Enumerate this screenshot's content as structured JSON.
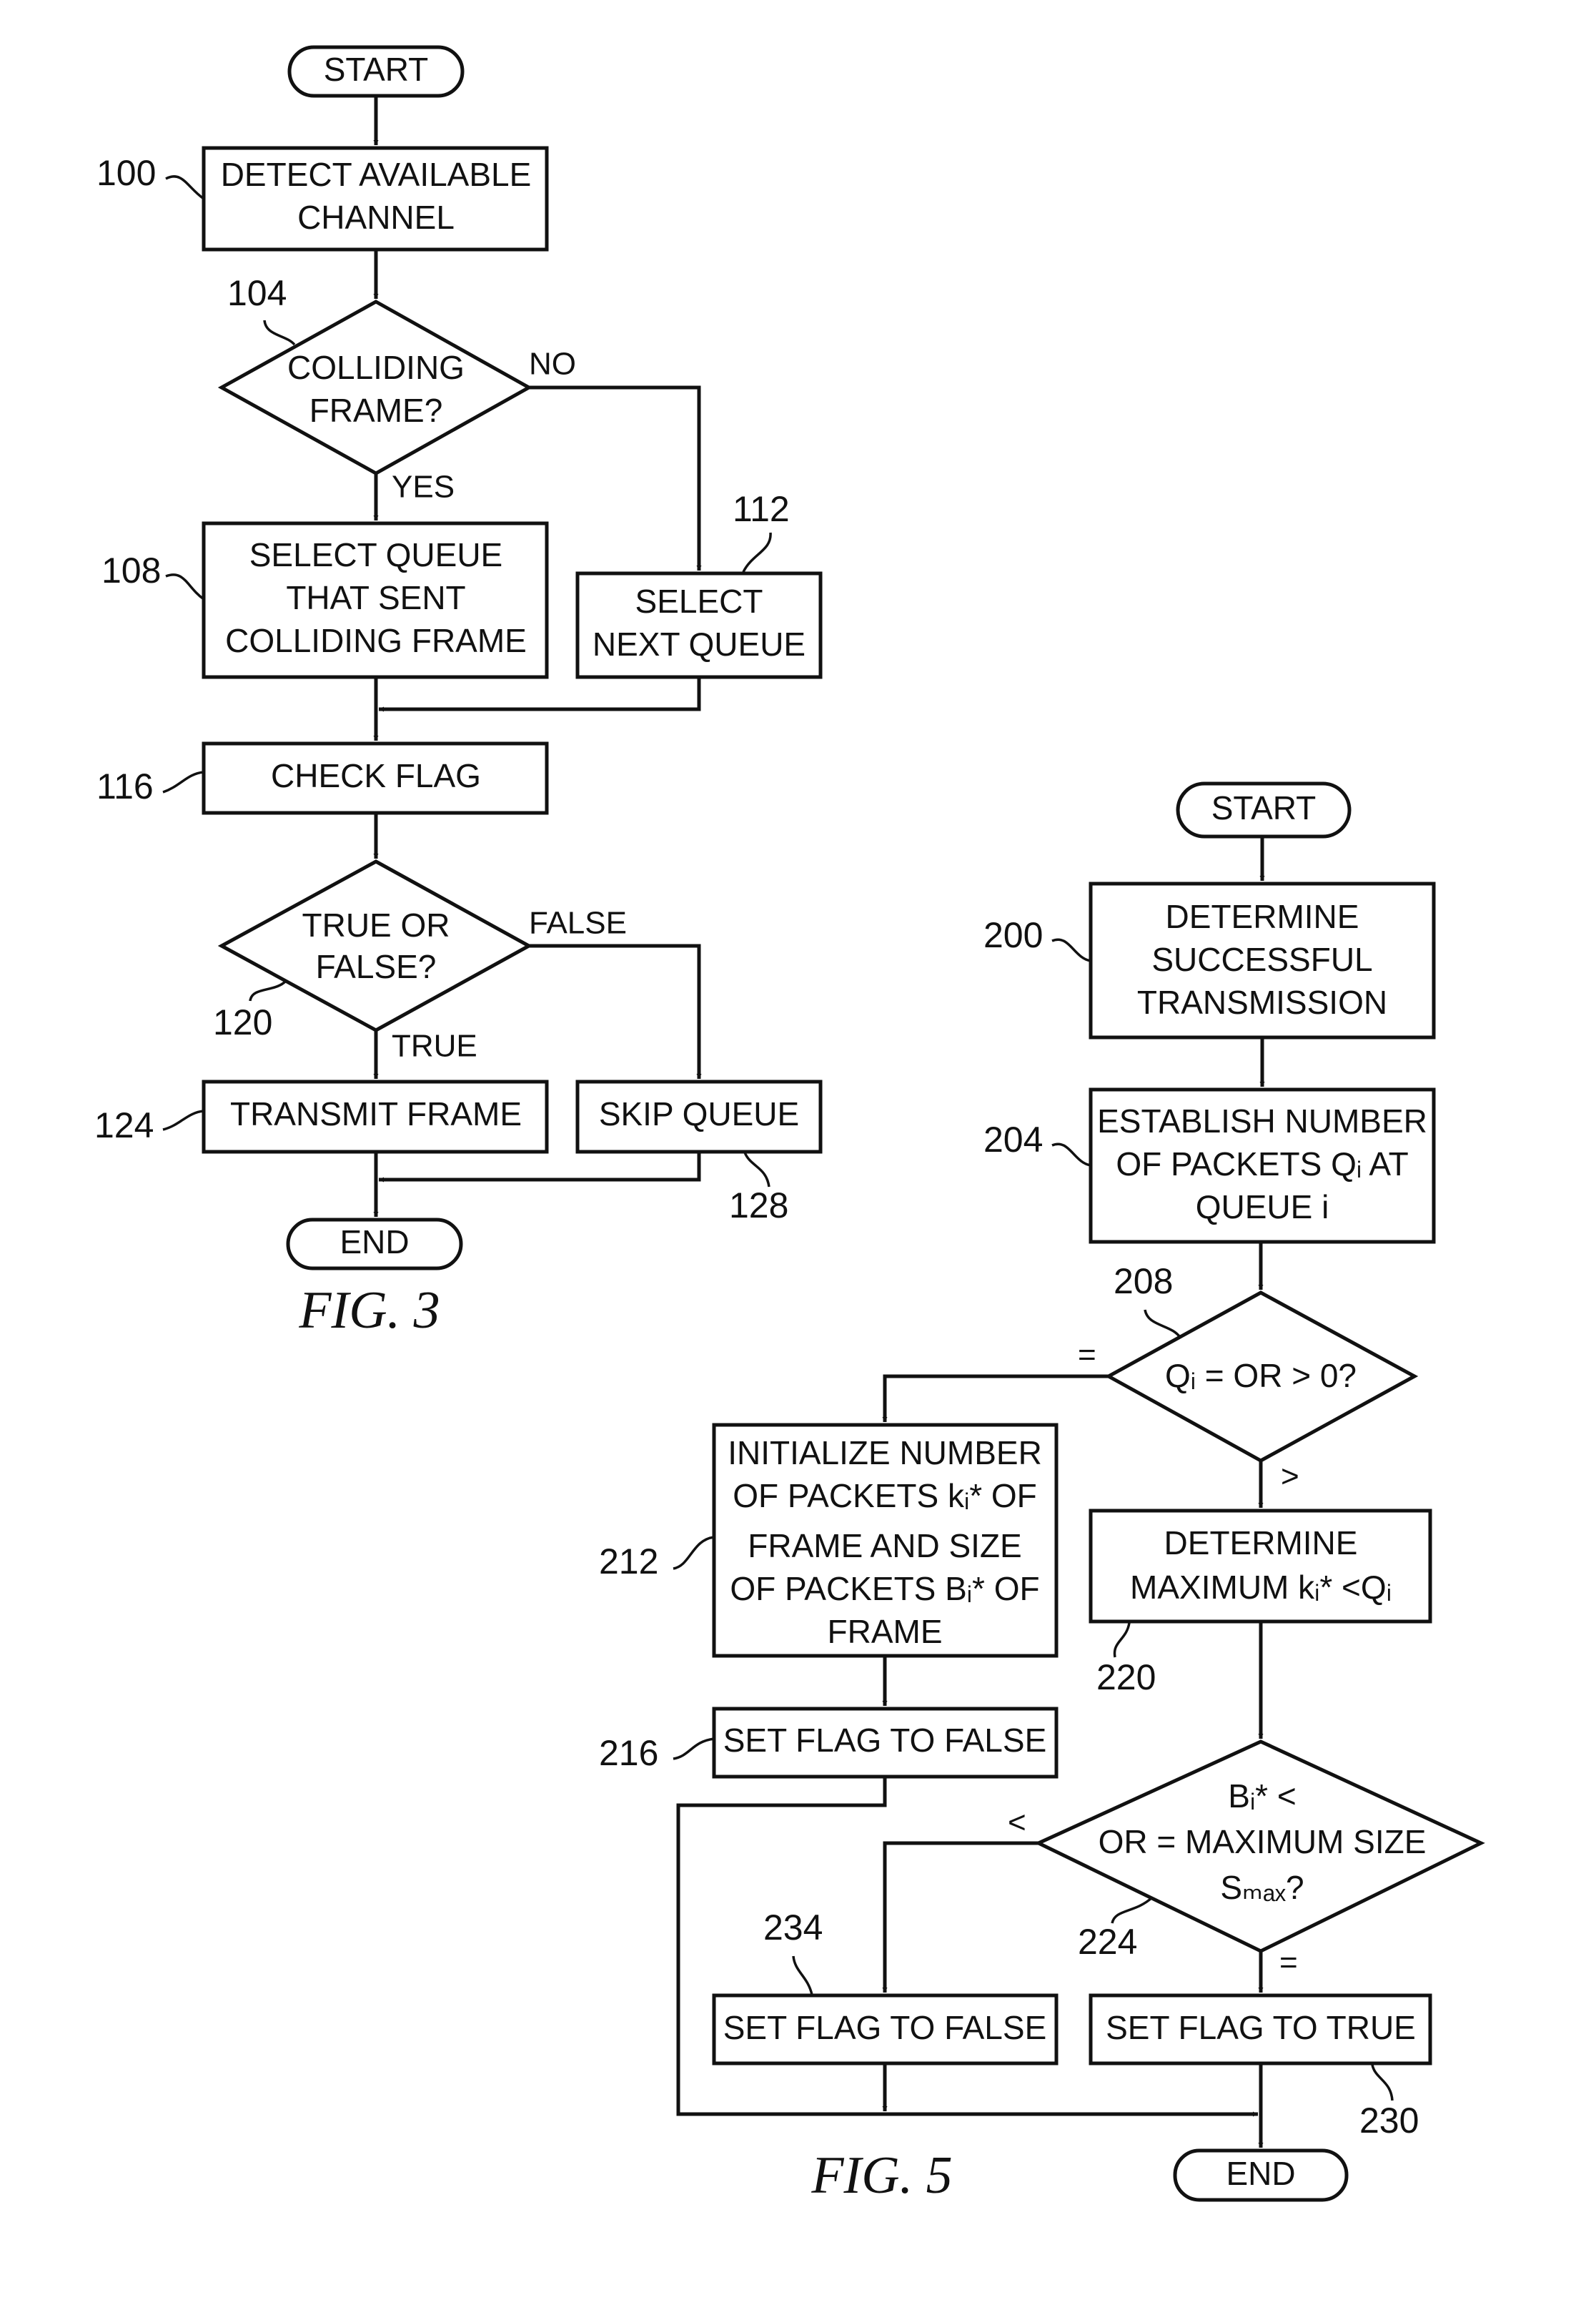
{
  "fig3": {
    "caption": "FIG. 3",
    "start": "START",
    "end": "END",
    "steps": {
      "s100": {
        "ref": "100",
        "lines": [
          "DETECT AVAILABLE",
          "CHANNEL"
        ]
      },
      "s104": {
        "ref": "104",
        "lines": [
          "COLLIDING",
          "FRAME?"
        ],
        "yes": "YES",
        "no": "NO"
      },
      "s108": {
        "ref": "108",
        "lines": [
          "SELECT QUEUE",
          "THAT SENT",
          "COLLIDING FRAME"
        ]
      },
      "s112": {
        "ref": "112",
        "lines": [
          "SELECT",
          "NEXT QUEUE"
        ]
      },
      "s116": {
        "ref": "116",
        "lines": [
          "CHECK FLAG"
        ]
      },
      "s120": {
        "ref": "120",
        "lines": [
          "TRUE OR",
          "FALSE?"
        ],
        "true": "TRUE",
        "false": "FALSE"
      },
      "s124": {
        "ref": "124",
        "lines": [
          "TRANSMIT FRAME"
        ]
      },
      "s128": {
        "ref": "128",
        "lines": [
          "SKIP QUEUE"
        ]
      }
    }
  },
  "fig5": {
    "caption": "FIG. 5",
    "start": "START",
    "end": "END",
    "steps": {
      "s200": {
        "ref": "200",
        "lines": [
          "DETERMINE",
          "SUCCESSFUL",
          "TRANSMISSION"
        ]
      },
      "s204": {
        "ref": "204",
        "lines": [
          "ESTABLISH NUMBER",
          "OF PACKETS Qᵢ AT",
          "QUEUE i"
        ]
      },
      "s208": {
        "ref": "208",
        "lines": [
          "Qᵢ = OR > 0?"
        ],
        "eq": "=",
        "gt": ">"
      },
      "s212": {
        "ref": "212",
        "lines": [
          "INITIALIZE NUMBER",
          "OF PACKETS kᵢ* OF",
          "FRAME AND SIZE",
          "OF PACKETS Bᵢ* OF",
          "FRAME"
        ]
      },
      "s216": {
        "ref": "216",
        "lines": [
          "SET FLAG TO FALSE"
        ]
      },
      "s220": {
        "ref": "220",
        "lines": [
          "DETERMINE",
          "MAXIMUM kᵢ* <Qᵢ"
        ]
      },
      "s224": {
        "ref": "224",
        "lines": [
          "Bᵢ* <",
          "OR = MAXIMUM SIZE",
          "Sₘₐₓ?"
        ],
        "lt": "<",
        "eq": "="
      },
      "s230": {
        "ref": "230",
        "lines": [
          "SET FLAG TO TRUE"
        ]
      },
      "s234": {
        "ref": "234",
        "lines": [
          "SET FLAG TO FALSE"
        ]
      }
    }
  }
}
